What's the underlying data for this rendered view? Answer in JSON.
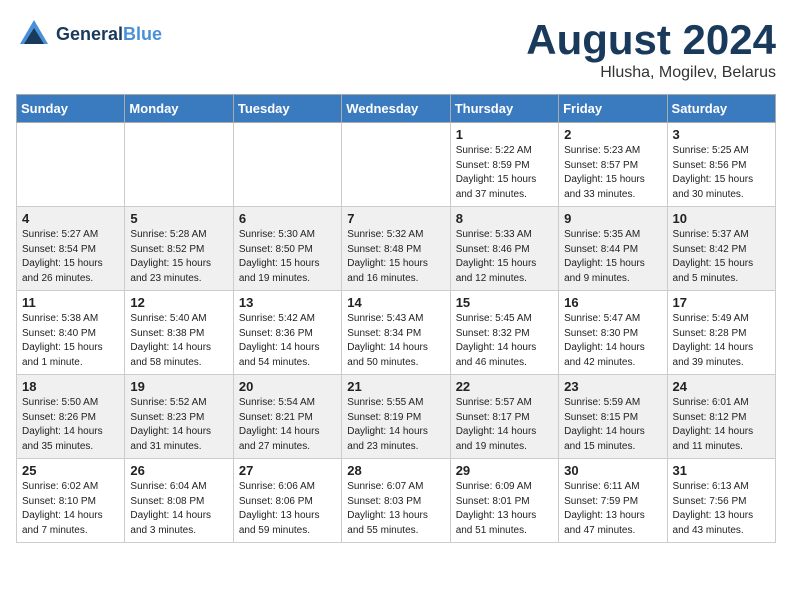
{
  "header": {
    "logo_line1": "General",
    "logo_line2": "Blue",
    "month_year": "August 2024",
    "location": "Hlusha, Mogilev, Belarus"
  },
  "weekdays": [
    "Sunday",
    "Monday",
    "Tuesday",
    "Wednesday",
    "Thursday",
    "Friday",
    "Saturday"
  ],
  "weeks": [
    [
      {
        "day": "",
        "info": ""
      },
      {
        "day": "",
        "info": ""
      },
      {
        "day": "",
        "info": ""
      },
      {
        "day": "",
        "info": ""
      },
      {
        "day": "1",
        "info": "Sunrise: 5:22 AM\nSunset: 8:59 PM\nDaylight: 15 hours\nand 37 minutes."
      },
      {
        "day": "2",
        "info": "Sunrise: 5:23 AM\nSunset: 8:57 PM\nDaylight: 15 hours\nand 33 minutes."
      },
      {
        "day": "3",
        "info": "Sunrise: 5:25 AM\nSunset: 8:56 PM\nDaylight: 15 hours\nand 30 minutes."
      }
    ],
    [
      {
        "day": "4",
        "info": "Sunrise: 5:27 AM\nSunset: 8:54 PM\nDaylight: 15 hours\nand 26 minutes."
      },
      {
        "day": "5",
        "info": "Sunrise: 5:28 AM\nSunset: 8:52 PM\nDaylight: 15 hours\nand 23 minutes."
      },
      {
        "day": "6",
        "info": "Sunrise: 5:30 AM\nSunset: 8:50 PM\nDaylight: 15 hours\nand 19 minutes."
      },
      {
        "day": "7",
        "info": "Sunrise: 5:32 AM\nSunset: 8:48 PM\nDaylight: 15 hours\nand 16 minutes."
      },
      {
        "day": "8",
        "info": "Sunrise: 5:33 AM\nSunset: 8:46 PM\nDaylight: 15 hours\nand 12 minutes."
      },
      {
        "day": "9",
        "info": "Sunrise: 5:35 AM\nSunset: 8:44 PM\nDaylight: 15 hours\nand 9 minutes."
      },
      {
        "day": "10",
        "info": "Sunrise: 5:37 AM\nSunset: 8:42 PM\nDaylight: 15 hours\nand 5 minutes."
      }
    ],
    [
      {
        "day": "11",
        "info": "Sunrise: 5:38 AM\nSunset: 8:40 PM\nDaylight: 15 hours\nand 1 minute."
      },
      {
        "day": "12",
        "info": "Sunrise: 5:40 AM\nSunset: 8:38 PM\nDaylight: 14 hours\nand 58 minutes."
      },
      {
        "day": "13",
        "info": "Sunrise: 5:42 AM\nSunset: 8:36 PM\nDaylight: 14 hours\nand 54 minutes."
      },
      {
        "day": "14",
        "info": "Sunrise: 5:43 AM\nSunset: 8:34 PM\nDaylight: 14 hours\nand 50 minutes."
      },
      {
        "day": "15",
        "info": "Sunrise: 5:45 AM\nSunset: 8:32 PM\nDaylight: 14 hours\nand 46 minutes."
      },
      {
        "day": "16",
        "info": "Sunrise: 5:47 AM\nSunset: 8:30 PM\nDaylight: 14 hours\nand 42 minutes."
      },
      {
        "day": "17",
        "info": "Sunrise: 5:49 AM\nSunset: 8:28 PM\nDaylight: 14 hours\nand 39 minutes."
      }
    ],
    [
      {
        "day": "18",
        "info": "Sunrise: 5:50 AM\nSunset: 8:26 PM\nDaylight: 14 hours\nand 35 minutes."
      },
      {
        "day": "19",
        "info": "Sunrise: 5:52 AM\nSunset: 8:23 PM\nDaylight: 14 hours\nand 31 minutes."
      },
      {
        "day": "20",
        "info": "Sunrise: 5:54 AM\nSunset: 8:21 PM\nDaylight: 14 hours\nand 27 minutes."
      },
      {
        "day": "21",
        "info": "Sunrise: 5:55 AM\nSunset: 8:19 PM\nDaylight: 14 hours\nand 23 minutes."
      },
      {
        "day": "22",
        "info": "Sunrise: 5:57 AM\nSunset: 8:17 PM\nDaylight: 14 hours\nand 19 minutes."
      },
      {
        "day": "23",
        "info": "Sunrise: 5:59 AM\nSunset: 8:15 PM\nDaylight: 14 hours\nand 15 minutes."
      },
      {
        "day": "24",
        "info": "Sunrise: 6:01 AM\nSunset: 8:12 PM\nDaylight: 14 hours\nand 11 minutes."
      }
    ],
    [
      {
        "day": "25",
        "info": "Sunrise: 6:02 AM\nSunset: 8:10 PM\nDaylight: 14 hours\nand 7 minutes."
      },
      {
        "day": "26",
        "info": "Sunrise: 6:04 AM\nSunset: 8:08 PM\nDaylight: 14 hours\nand 3 minutes."
      },
      {
        "day": "27",
        "info": "Sunrise: 6:06 AM\nSunset: 8:06 PM\nDaylight: 13 hours\nand 59 minutes."
      },
      {
        "day": "28",
        "info": "Sunrise: 6:07 AM\nSunset: 8:03 PM\nDaylight: 13 hours\nand 55 minutes."
      },
      {
        "day": "29",
        "info": "Sunrise: 6:09 AM\nSunset: 8:01 PM\nDaylight: 13 hours\nand 51 minutes."
      },
      {
        "day": "30",
        "info": "Sunrise: 6:11 AM\nSunset: 7:59 PM\nDaylight: 13 hours\nand 47 minutes."
      },
      {
        "day": "31",
        "info": "Sunrise: 6:13 AM\nSunset: 7:56 PM\nDaylight: 13 hours\nand 43 minutes."
      }
    ]
  ]
}
